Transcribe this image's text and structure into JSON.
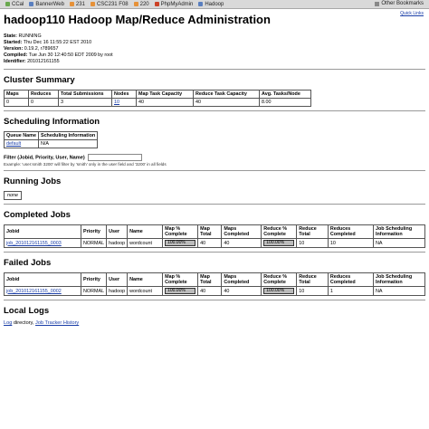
{
  "bookmarks": [
    {
      "label": "CCal",
      "icon": "calendar-icon"
    },
    {
      "label": "BannerWeb",
      "icon": "web-icon"
    },
    {
      "label": "231",
      "icon": "bookmark-icon"
    },
    {
      "label": "CSC231 F08",
      "icon": "bookmark-icon"
    },
    {
      "label": "220",
      "icon": "bookmark-icon"
    },
    {
      "label": "PhpMyAdmin",
      "icon": "database-icon"
    },
    {
      "label": "Hadoop",
      "icon": "bookmark-icon"
    }
  ],
  "other_bookmarks": "Other Bookmarks",
  "quick_links": "Quick Links",
  "title": "hadoop110 Hadoop Map/Reduce Administration",
  "meta": [
    {
      "key": "State:",
      "value": "RUNNING"
    },
    {
      "key": "Started:",
      "value": "Thu Dec 16 11:55:22 EST 2010"
    },
    {
      "key": "Version:",
      "value": "0.19.2, r789657"
    },
    {
      "key": "Compiled:",
      "value": "Tue Jun 30 12:40:50 EDT 2009 by root"
    },
    {
      "key": "Identifier:",
      "value": "201012161155"
    }
  ],
  "cluster_summary": {
    "heading": "Cluster Summary",
    "headers": [
      "Maps",
      "Reduces",
      "Total Submissions",
      "Nodes",
      "Map Task Capacity",
      "Reduce Task Capacity",
      "Avg. Tasks/Node"
    ],
    "row": [
      "0",
      "0",
      "3",
      "10",
      "40",
      "40",
      "8.00"
    ]
  },
  "scheduling": {
    "heading": "Scheduling Information",
    "headers": [
      "Queue Name",
      "Scheduling Information"
    ],
    "row": [
      "default",
      "N/A"
    ]
  },
  "filter": {
    "label": "Filter (Jobid, Priority, User, Name)",
    "value": "",
    "example": "Example: 'user:smith 3200' will filter by 'smith' only in the user field and '3200' in all fields"
  },
  "running": {
    "heading": "Running Jobs",
    "none": "none"
  },
  "completed": {
    "heading": "Completed Jobs",
    "headers": [
      "Jobid",
      "Priority",
      "User",
      "Name",
      "Map % Complete",
      "Map Total",
      "Maps Completed",
      "Reduce % Complete",
      "Reduce Total",
      "Reduces Completed",
      "Job Scheduling Information"
    ],
    "row": {
      "jobid": "job_201012161155_0003",
      "priority": "NORMAL",
      "user": "hadoop",
      "name": "wordcount",
      "map_pct_text": "100.00%",
      "map_pct": 100,
      "map_total": "40",
      "maps_completed": "40",
      "reduce_pct_text": "100.00%",
      "reduce_pct": 100,
      "reduce_total": "10",
      "reduces_completed": "10",
      "sched_info": "NA"
    }
  },
  "failed": {
    "heading": "Failed Jobs",
    "headers": [
      "Jobid",
      "Priority",
      "User",
      "Name",
      "Map % Complete",
      "Map Total",
      "Maps Completed",
      "Reduce % Complete",
      "Reduce Total",
      "Reduces Completed",
      "Job Scheduling Information"
    ],
    "row": {
      "jobid": "job_201012161155_0002",
      "priority": "NORMAL",
      "user": "hadoop",
      "name": "wordcount",
      "map_pct_text": "100.00%",
      "map_pct": 100,
      "map_total": "40",
      "maps_completed": "40",
      "reduce_pct_text": "100.00%",
      "reduce_pct": 100,
      "reduce_total": "10",
      "reduces_completed": "1",
      "sched_info": "NA"
    }
  },
  "local_logs": {
    "heading": "Local Logs",
    "log_link": "Log",
    "log_suffix": " directory, ",
    "history_link": "Job Tracker History"
  }
}
